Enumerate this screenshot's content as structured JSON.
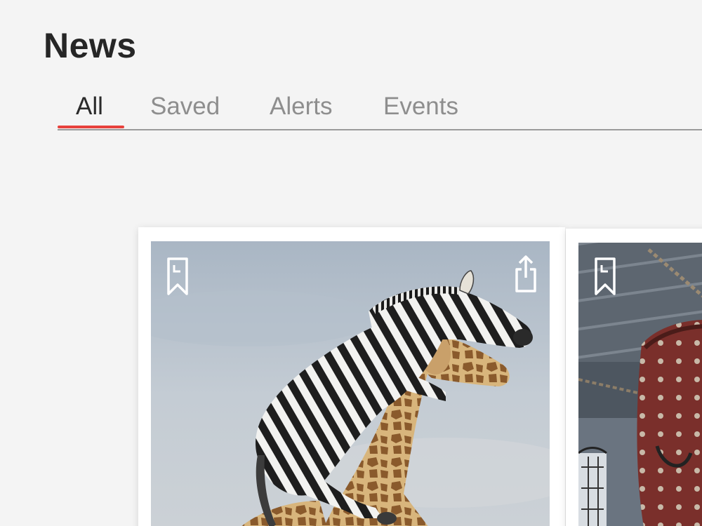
{
  "page": {
    "title": "News"
  },
  "tabs": [
    {
      "label": "All",
      "active": true
    },
    {
      "label": "Saved",
      "active": false
    },
    {
      "label": "Alerts",
      "active": false
    },
    {
      "label": "Events",
      "active": false
    }
  ],
  "colors": {
    "background": "#f4f4f4",
    "accent": "#e8413c",
    "title_text": "#262626",
    "tab_inactive": "#8e8e8e",
    "tab_active": "#2a2a2a"
  },
  "cards": [
    {
      "image": "zebra-riding-giraffe-photo",
      "actions": [
        "bookmark-icon",
        "share-icon"
      ]
    },
    {
      "image": "industrial-hangar-photo",
      "actions": [
        "bookmark-icon"
      ]
    }
  ]
}
